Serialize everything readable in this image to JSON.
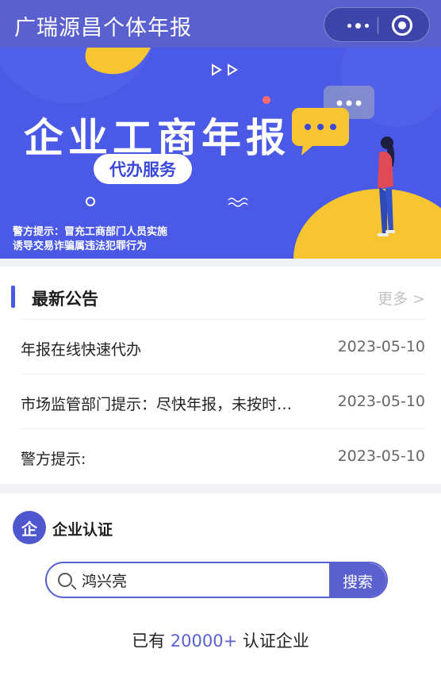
{
  "header": {
    "title": "广瑞源昌个体年报"
  },
  "banner": {
    "title": "企业工商年报",
    "pill": "代办服务",
    "warning_line1": "警方提示：冒充工商部门人员实施",
    "warning_line2": "诱导交易诈骗属违法犯罪行为"
  },
  "notices": {
    "section_title": "最新公告",
    "more_label": "更多 >",
    "items": [
      {
        "title": "年报在线快速代办",
        "date": "2023-05-10"
      },
      {
        "title": "市场监管部门提示：尽快年报，未按时…",
        "date": "2023-05-10"
      },
      {
        "title": "警方提示:",
        "date": "2023-05-10"
      }
    ]
  },
  "enterprise": {
    "icon_char": "企",
    "title": "企业认证",
    "search_value": "鸿兴亮",
    "search_button": "搜索",
    "count_prefix": "已有",
    "count_number": "20000+",
    "count_suffix": "认证企业"
  },
  "colors": {
    "brand": "#5a61cf",
    "banner": "#4a59e6",
    "accent_yellow": "#f7c531"
  }
}
